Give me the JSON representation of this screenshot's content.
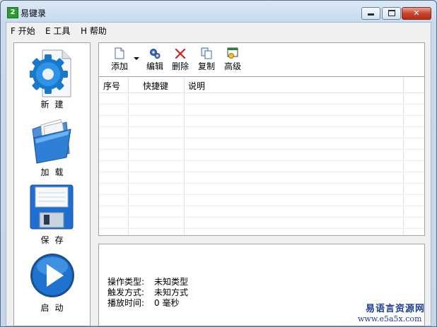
{
  "window": {
    "title": "易键录",
    "app_icon_glyph": "2",
    "close_glyph": "✕"
  },
  "menu": {
    "items": [
      {
        "label": "F 开始"
      },
      {
        "label": "E 工具"
      },
      {
        "label": "H 帮助"
      }
    ]
  },
  "left_panel": {
    "buttons": [
      {
        "label": "新建",
        "icon": "gear-document-icon"
      },
      {
        "label": "加载",
        "icon": "open-folder-icon"
      },
      {
        "label": "保存",
        "icon": "floppy-disk-icon"
      },
      {
        "label": "启动",
        "icon": "play-icon"
      }
    ]
  },
  "toolbar": {
    "add": "添加",
    "edit": "编辑",
    "delete": "删除",
    "copy": "复制",
    "advanced": "高级"
  },
  "list": {
    "columns": [
      "序号",
      "快捷键",
      "说明"
    ],
    "rows": []
  },
  "info": {
    "op_type_label": "操作类型:",
    "op_type_value": "未知类型",
    "trigger_label": "触发方式:",
    "trigger_value": "未知方式",
    "playback_label": "播放时间:",
    "playback_value": "0 毫秒"
  },
  "watermark": {
    "text": "易语言资源网",
    "url": "www.e5a5x.com"
  },
  "colors": {
    "accent": "#1f6fc0",
    "close_button": "#c8452f",
    "watermark": "#1f3f8f"
  }
}
